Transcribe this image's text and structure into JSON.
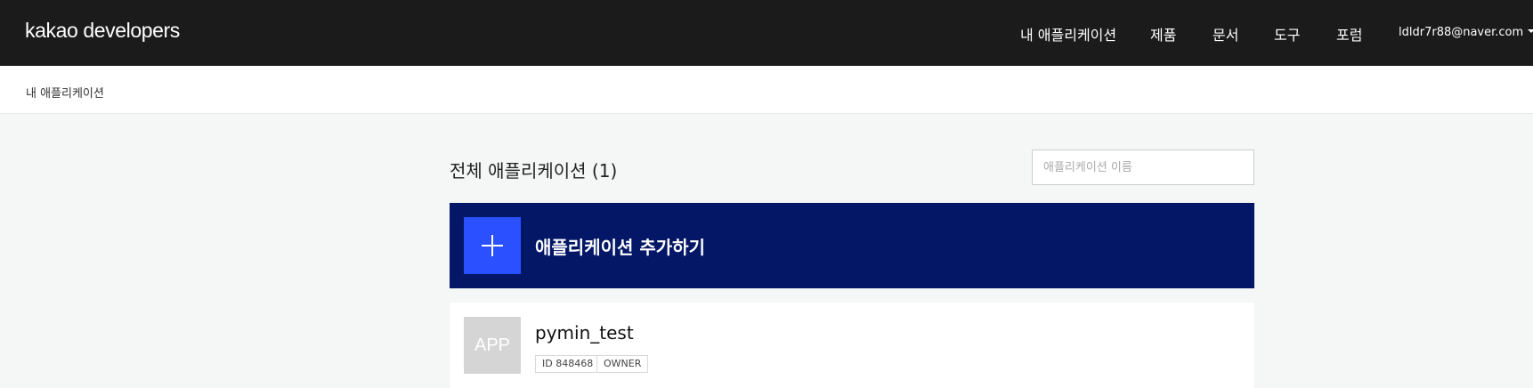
{
  "header": {
    "logo": "kakao developers",
    "nav": [
      "내 애플리케이션",
      "제품",
      "문서",
      "도구",
      "포럼"
    ],
    "user_email": "ldldr7r88@naver.com"
  },
  "breadcrumb": "내 애플리케이션",
  "main": {
    "title": "전체 애플리케이션 (1)",
    "search_placeholder": "애플리케이션 이름",
    "add_app_label": "애플리케이션 추가하기",
    "apps": [
      {
        "thumb": "APP",
        "name": "pymin_test",
        "id_tag": "ID 848468",
        "role_tag": "OWNER"
      }
    ]
  },
  "colors": {
    "header_bg": "#1b1b1c",
    "add_banner_bg": "#031766",
    "add_icon_bg": "#2b50ff"
  }
}
